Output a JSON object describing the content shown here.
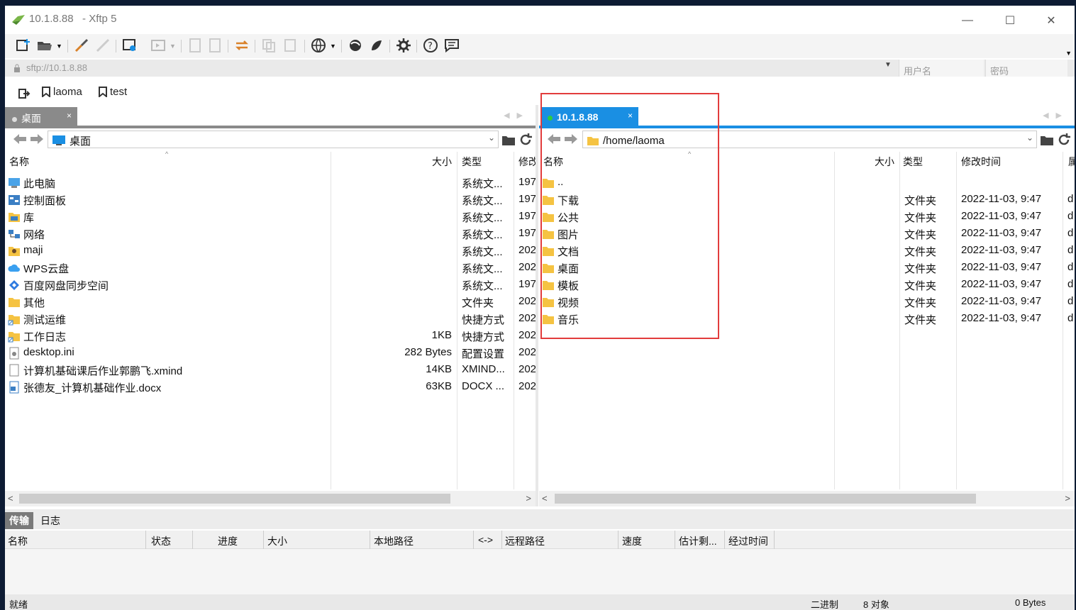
{
  "window": {
    "title": "10.1.8.88   - Xftp 5",
    "controls": {
      "minimize": "—",
      "maximize": "☐",
      "close": "✕"
    }
  },
  "address": {
    "value": "sftp://10.1.8.88",
    "username_placeholder": "用户名",
    "password_placeholder": "密码"
  },
  "bookmarks": [
    "laoma",
    "test"
  ],
  "local": {
    "tab_label": "桌面",
    "path": "桌面",
    "columns": {
      "name": "名称",
      "size": "大小",
      "type": "类型",
      "modified": "修改"
    },
    "files": [
      {
        "name": "此电脑",
        "size": "",
        "type": "系统文...",
        "modified": "197",
        "icon": "computer-icon"
      },
      {
        "name": "控制面板",
        "size": "",
        "type": "系统文...",
        "modified": "197",
        "icon": "control-panel-icon"
      },
      {
        "name": "库",
        "size": "",
        "type": "系统文...",
        "modified": "197",
        "icon": "library-icon"
      },
      {
        "name": "网络",
        "size": "",
        "type": "系统文...",
        "modified": "197",
        "icon": "network-icon"
      },
      {
        "name": "maji",
        "size": "",
        "type": "系统文...",
        "modified": "202",
        "icon": "user-folder-icon"
      },
      {
        "name": "WPS云盘",
        "size": "",
        "type": "系统文...",
        "modified": "202",
        "icon": "cloud-icon"
      },
      {
        "name": "百度网盘同步空间",
        "size": "",
        "type": "系统文...",
        "modified": "197",
        "icon": "baidu-cloud-icon"
      },
      {
        "name": "其他",
        "size": "",
        "type": "文件夹",
        "modified": "202",
        "icon": "folder-icon"
      },
      {
        "name": "测试运维",
        "size": "",
        "type": "快捷方式",
        "modified": "202",
        "icon": "shortcut-icon"
      },
      {
        "name": "工作日志",
        "size": "1KB",
        "type": "快捷方式",
        "modified": "202",
        "icon": "shortcut-icon"
      },
      {
        "name": "desktop.ini",
        "size": "282 Bytes",
        "type": "配置设置",
        "modified": "202",
        "icon": "ini-file-icon"
      },
      {
        "name": "计算机基础课后作业郭鹏飞.xmind",
        "size": "14KB",
        "type": "XMIND...",
        "modified": "202",
        "icon": "file-icon"
      },
      {
        "name": "张德友_计算机基础作业.docx",
        "size": "63KB",
        "type": "DOCX ...",
        "modified": "202",
        "icon": "docx-icon"
      }
    ]
  },
  "remote": {
    "tab_label": "10.1.8.88",
    "path": "/home/laoma",
    "columns": {
      "name": "名称",
      "size": "大小",
      "type": "类型",
      "modified": "修改时间",
      "perm": "属"
    },
    "files": [
      {
        "name": "..",
        "type": "",
        "modified": "",
        "perm": ""
      },
      {
        "name": "下载",
        "type": "文件夹",
        "modified": "2022-11-03, 9:47",
        "perm": "d"
      },
      {
        "name": "公共",
        "type": "文件夹",
        "modified": "2022-11-03, 9:47",
        "perm": "d"
      },
      {
        "name": "图片",
        "type": "文件夹",
        "modified": "2022-11-03, 9:47",
        "perm": "d"
      },
      {
        "name": "文档",
        "type": "文件夹",
        "modified": "2022-11-03, 9:47",
        "perm": "d"
      },
      {
        "name": "桌面",
        "type": "文件夹",
        "modified": "2022-11-03, 9:47",
        "perm": "d"
      },
      {
        "name": "模板",
        "type": "文件夹",
        "modified": "2022-11-03, 9:47",
        "perm": "d"
      },
      {
        "name": "视频",
        "type": "文件夹",
        "modified": "2022-11-03, 9:47",
        "perm": "d"
      },
      {
        "name": "音乐",
        "type": "文件夹",
        "modified": "2022-11-03, 9:47",
        "perm": "d"
      }
    ]
  },
  "transfer": {
    "tabs": [
      "传输",
      "日志"
    ],
    "columns": [
      "名称",
      "状态",
      "进度",
      "大小",
      "本地路径",
      "<->",
      "远程路径",
      "速度",
      "估计剩...",
      "经过时间"
    ]
  },
  "status": {
    "left": "就绪",
    "mode": "二进制",
    "objects": "8 对象",
    "size": "0 Bytes"
  },
  "colors": {
    "accent": "#1a8fe3",
    "highlight": "#e23c3c",
    "folder": "#f5c342"
  }
}
